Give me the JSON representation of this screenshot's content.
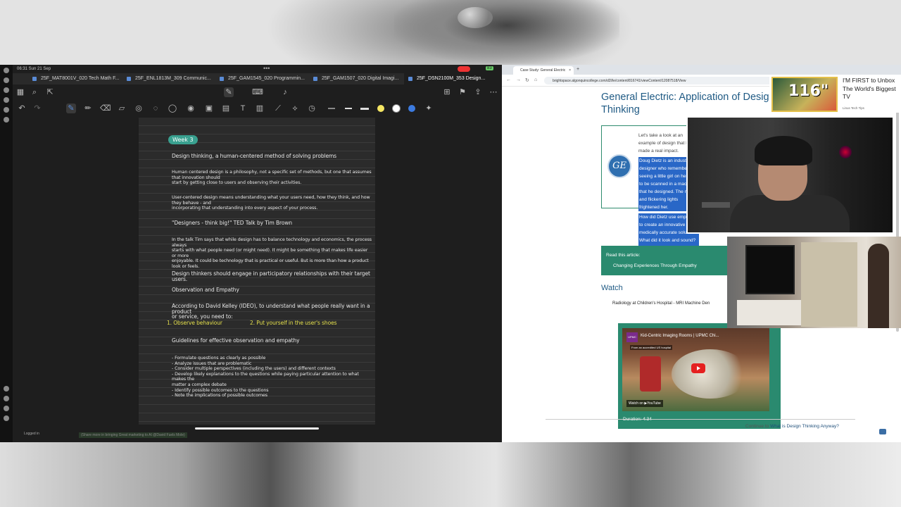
{
  "notes_app": {
    "status": {
      "time": "06:31  Sun 21 Sep",
      "battery": "83"
    },
    "tabs": [
      {
        "label": "25F_MAT8001V_020 Tech Math F..."
      },
      {
        "label": "25F_ENL1813M_309 Communic..."
      },
      {
        "label": "25F_GAM1545_020 Programmin..."
      },
      {
        "label": "25F_GAM1507_020 Digital Imagi..."
      },
      {
        "label": "25F_DSN2100M_353 Design..."
      }
    ],
    "pen_colors": [
      "#f5e663",
      "#ffffff",
      "#3c7be0"
    ],
    "week_badge": "Week 3",
    "lines": [
      "Design thinking, a human-centered method of solving problems",
      "Human centered design is a philosophy, not a specific set of methods, but one that assumes that innovation should\nstart by getting close to users and observing their activities.",
      "User-centered design means understanding what your users need, how they think, and how they behave - and\nincorporating that understanding into every aspect of your process.",
      "\"Designers - think big!\" TED Talk by Tim Brown",
      "In the talk Tim says that while design has to balance technology and economics, the process always\nstarts with what people need (or might need). It might be something that makes life easier or more\nenjoyable. It could be technology that is practical or useful. But is more than how a product look or feels.",
      "Design thinkers should engage in participatory relationships with their target users.",
      "Observation and Empathy",
      "According to David Kelley (IDEO), to understand what people really want in a product\nor service, you need to:",
      "Guidelines for effective observation and empathy",
      "- Formulate questions as clearly as possible\n- Analyze issues that are problematic\n- Consider multiple perspectives (including the users) and different contexts\n- Develop likely explanations to the questions while paying particular attention to what makes the\n  matter a complex debate\n- Identify possible outcomes to the questions\n- Note the implications of possible outcomes"
    ],
    "steps": {
      "one": "1. Observe behaviour",
      "two": "2. Put yourself in the user's shoes"
    },
    "logged_in": "Logged in",
    "bottom_note": "(Share more in bringing Great marketing to AI @David Fuels Mole)"
  },
  "browser": {
    "tab_title": "Case Study: General Electric",
    "url": "brightspace.algonquincollege.com/d2l/le/content/816741/viewContent/12087518/View",
    "heading": "General Electric:  Application of Design Thinking",
    "card": {
      "logo": "GE",
      "intro": "Let's take a look at an example of design that has made a real impact.",
      "para1": "Doug Dietz is an industrial designer who remembers seeing a little girl on her way to be scanned in a machine that he designed. The noises and flickering lights frightened her.",
      "para2": "How did Dietz use empathy to create an innovative yet medically accurate solution? What did it look and sound? Read this article."
    },
    "read_label": "Read this article:",
    "read_link": "Changing Experiences Through Empathy",
    "watch_heading": "Watch",
    "video_title": "Radiology at Children's Hospital - MRI Machine Den",
    "video": {
      "name": "Kid-Centric Imaging Rooms | UPMC Chi...",
      "sub": "From an accredited US hospital",
      "channel_logo": "UPMC",
      "watch_on": "Watch on ▶YouTube",
      "duration": "Duration: 4:34"
    },
    "continue_prefix": "Continue to",
    "continue_link": "What is Design Thinking Anyway?"
  },
  "overlay": {
    "ad_number": "116\"",
    "ad_text": "I'M FIRST to Unbox The World's Biggest TV",
    "ad_source": "Linus Tech Tips"
  }
}
